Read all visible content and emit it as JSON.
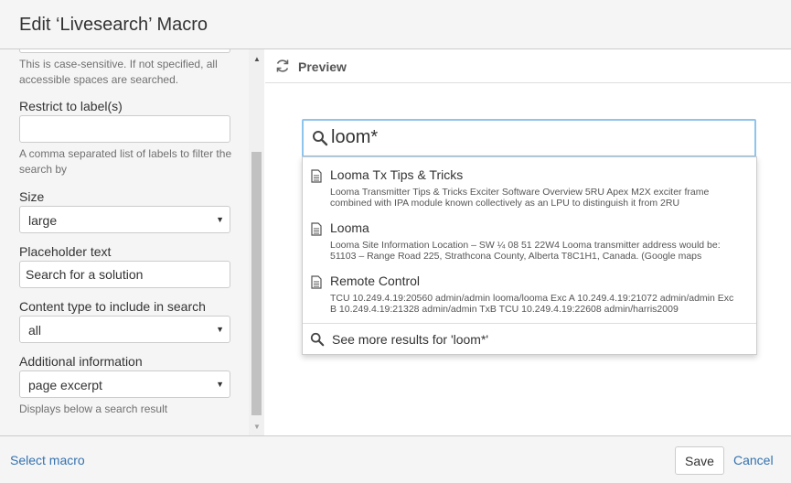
{
  "dialog": {
    "title": "Edit ‘Livesearch’ Macro"
  },
  "form": {
    "spaces_help": "This is case-sensitive. If not specified, all accessible spaces are searched.",
    "labels_label": "Restrict to label(s)",
    "labels_value": "",
    "labels_help": "A comma separated list of labels to filter the search by",
    "size_label": "Size",
    "size_value": "large",
    "placeholder_label": "Placeholder text",
    "placeholder_value": "Search for a solution",
    "content_type_label": "Content type to include in search",
    "content_type_value": "all",
    "additional_label": "Additional information",
    "additional_value": "page excerpt",
    "additional_help": "Displays below a search result"
  },
  "preview": {
    "title": "Preview",
    "search_value": "loom*",
    "results": [
      {
        "title": "Looma Tx Tips & Tricks",
        "excerpt": "Looma Transmitter Tips & Tricks Exciter Software Overview 5RU Apex M2X exciter frame combined with IPA module known collectively as an LPU to distinguish it from 2RU"
      },
      {
        "title": "Looma",
        "excerpt": "Looma Site Information Location – SW ¼ 08 51 22W4 Looma transmitter address would be: 51103 – Range Road 225, Strathcona County, Alberta T8C1H1, Canada. (Google maps"
      },
      {
        "title": "Remote Control",
        "excerpt": "TCU 10.249.4.19:20560 admin/admin looma/looma Exc A 10.249.4.19:21072 admin/admin Exc B 10.249.4.19:21328 admin/admin TxB TCU 10.249.4.19:22608 admin/harris2009"
      }
    ],
    "more_results": "See more results for 'loom*'"
  },
  "footer": {
    "select_macro": "Select macro",
    "save": "Save",
    "cancel": "Cancel"
  },
  "colors": {
    "link": "#3572b0",
    "focus_border": "#8ec5ec",
    "panel_bg": "#f5f5f5"
  },
  "icons": {
    "refresh": "refresh-icon",
    "search": "search-icon",
    "document": "document-icon",
    "dropdown_arrow": "caret-down-icon"
  }
}
